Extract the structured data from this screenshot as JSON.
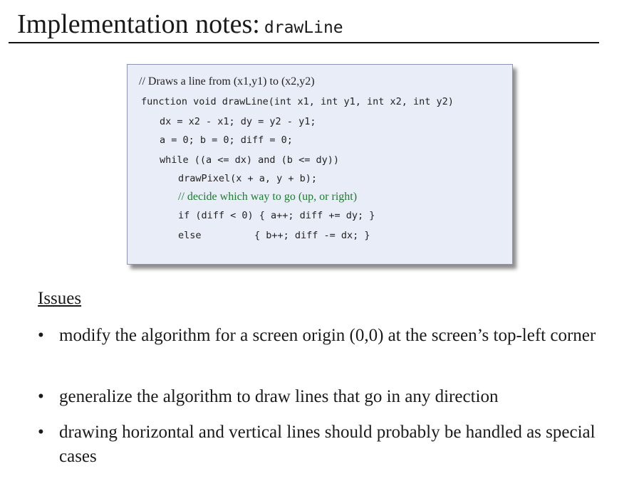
{
  "title": {
    "text": "Implementation notes:",
    "code": "drawLine"
  },
  "code": {
    "comment1": "// Draws a line from (x1,y1) to (x2,y2)",
    "signature": "function void drawLine(int x1, int y1, int x2, int y2)",
    "line_dx": "dx = x2 - x1; dy = y2 - y1;",
    "line_init": "a = 0; b = 0; diff = 0;",
    "line_while": "while ((a <= dx) and (b <= dy))",
    "line_draw": "drawPixel(x + a, y + b);",
    "comment2": "// decide which way to go (up, or right)",
    "line_if": "if (diff < 0) { a++; diff += dy; }",
    "line_else_kw": "else",
    "line_else_body": "{ b++; diff -= dx; }",
    "comment2_color": "#1d7a2e"
  },
  "issues_heading": "Issues",
  "bullets": [
    "modify the algorithm for a screen origin (0,0) at the screen’s top-left corner",
    "generalize the algorithm to draw lines that go in any direction",
    "drawing horizontal and vertical lines should probably be handled as special cases"
  ]
}
